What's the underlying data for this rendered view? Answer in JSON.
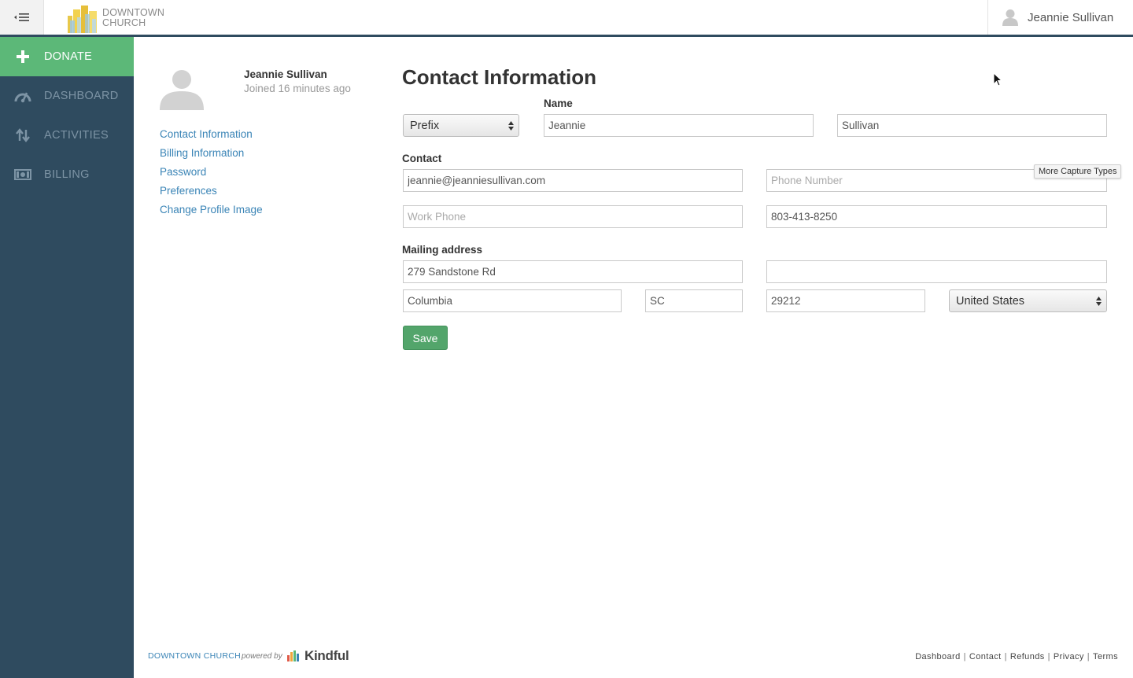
{
  "header": {
    "logo_line1": "DOWNTOWN",
    "logo_line2": "CHURCH",
    "user_name": "Jeannie Sullivan"
  },
  "sidebar": {
    "items": [
      {
        "label": "DONATE",
        "icon": "plus-icon"
      },
      {
        "label": "DASHBOARD",
        "icon": "speedometer-icon"
      },
      {
        "label": "ACTIVITIES",
        "icon": "transfer-arrows-icon"
      },
      {
        "label": "BILLING",
        "icon": "banknote-icon"
      }
    ]
  },
  "profile": {
    "name": "Jeannie Sullivan",
    "joined": "Joined 16 minutes ago",
    "links": [
      "Contact Information",
      "Billing Information",
      "Password",
      "Preferences",
      "Change Profile Image"
    ]
  },
  "form": {
    "title": "Contact Information",
    "name_label": "Name",
    "prefix": "Prefix",
    "first_name": "Jeannie",
    "last_name": "Sullivan",
    "contact_label": "Contact",
    "email": "jeannie@jeanniesullivan.com",
    "phone_placeholder": "Phone Number",
    "work_phone_placeholder": "Work Phone",
    "mobile_phone": "803-413-8250",
    "mailing_label": "Mailing address",
    "address1": "279 Sandstone Rd",
    "address2": "",
    "city": "Columbia",
    "state": "SC",
    "zip": "29212",
    "country": "United States",
    "save_label": "Save"
  },
  "tooltip": "More Capture Types",
  "footer": {
    "brand": "DOWNTOWN CHURCH",
    "powered_by": "powered by",
    "kindful": "Kindful",
    "links": [
      "Dashboard",
      "Contact",
      "Refunds",
      "Privacy",
      "Terms"
    ]
  },
  "colors": {
    "sidebar_bg": "#2f4b5f",
    "donate_green": "#5cb878",
    "link_blue": "#3a84b6",
    "save_green": "#53a56b"
  }
}
